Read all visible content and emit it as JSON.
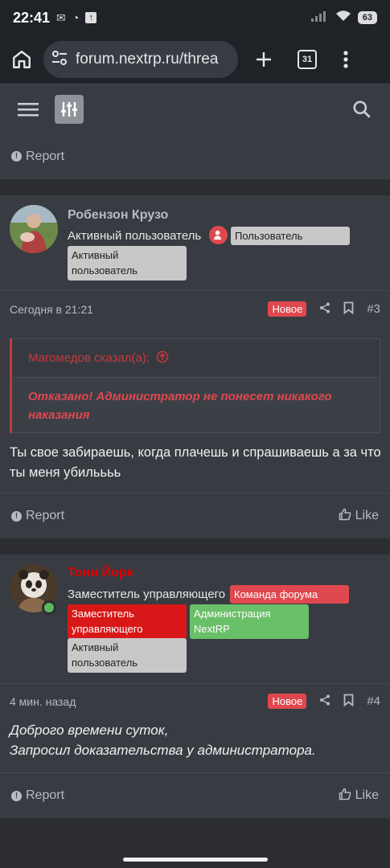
{
  "status_bar": {
    "time": "22:41",
    "battery": "63"
  },
  "browser": {
    "url": "forum.nextrp.ru/threa",
    "tab_count": "31"
  },
  "posts": [
    {
      "report_label": "Report"
    },
    {
      "username": "Робензон Крузо",
      "user_title": "Активный пользователь",
      "badges": [
        "Пользователь",
        "Активный пользователь"
      ],
      "date": "Сегодня в 21:21",
      "new_label": "Новое",
      "number": "#3",
      "quote_author": "Магомедов сказал(а):",
      "quote_text": "Отказано! Администратор не понесет никакого наказания",
      "message": "Ты свое забираешь, когда плачешь и спрашиваешь а за что ты меня убильььь",
      "report_label": "Report",
      "like_label": "Like"
    },
    {
      "username": "Тони Йорк",
      "user_title": "Заместитель управляющего",
      "badges": [
        "Команда форума",
        "Заместитель управляющего",
        "Администрация NextRP",
        "Активный пользователь"
      ],
      "date": "4 мин. назад",
      "new_label": "Новое",
      "number": "#4",
      "message_line1": "Доброго времени суток,",
      "message_line2": "Запросил доказательства у администратора.",
      "report_label": "Report",
      "like_label": "Like"
    }
  ],
  "colors": {
    "accent_red": "#e0484f",
    "username_red": "#e00000",
    "badge_grey": "#c8c8c8",
    "badge_green": "#6abf69",
    "badge_red_dark": "#d81818"
  },
  "icons": [
    "home-icon",
    "tune-icon",
    "plus-icon",
    "tab-switcher-icon",
    "more-vert-icon",
    "menu-icon",
    "filter-icon",
    "search-icon",
    "share-icon",
    "bookmark-icon",
    "like-icon",
    "info-icon",
    "arrow-up-circle-icon"
  ]
}
